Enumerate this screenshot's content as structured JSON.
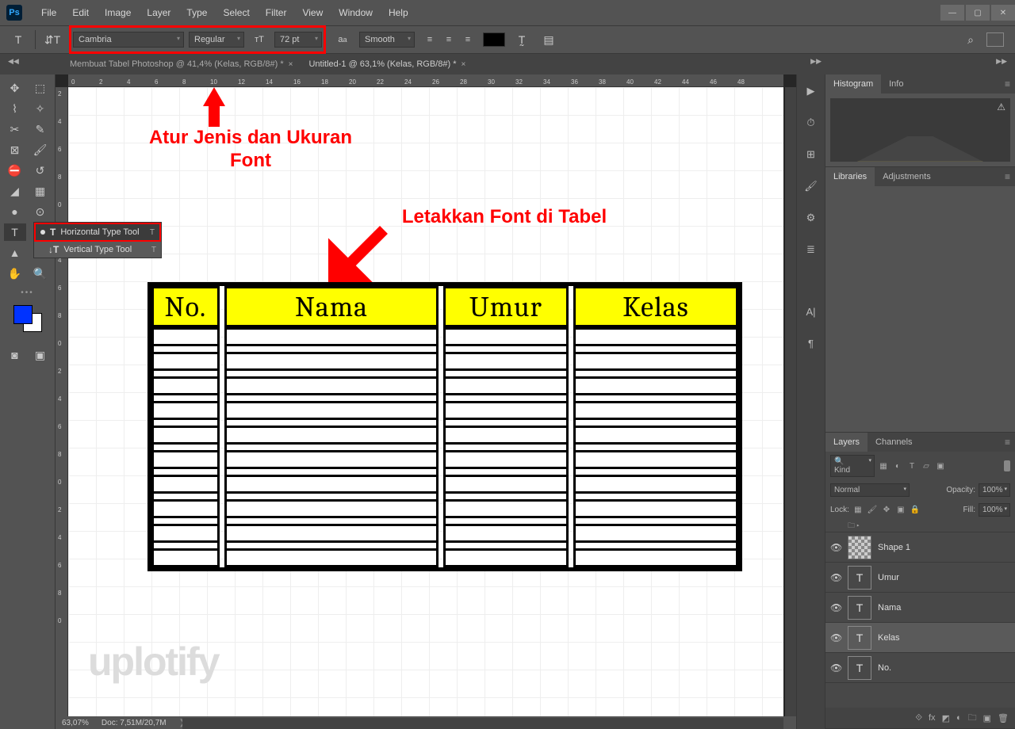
{
  "app": {
    "logo": "Ps"
  },
  "menu": [
    "File",
    "Edit",
    "Image",
    "Layer",
    "Type",
    "Select",
    "Filter",
    "View",
    "Window",
    "Help"
  ],
  "options": {
    "font": "Cambria",
    "style": "Regular",
    "size": "72 pt",
    "aa": "Smooth"
  },
  "tabs": [
    {
      "label": "Membuat Tabel Photoshop @ 41,4% (Kelas, RGB/8#) *",
      "active": false
    },
    {
      "label": "Untitled-1 @ 63,1% (Kelas, RGB/8#) *",
      "active": true
    }
  ],
  "flyout": {
    "items": [
      {
        "label": "Horizontal Type Tool",
        "shortcut": "T",
        "selected": true
      },
      {
        "label": "Vertical Type Tool",
        "shortcut": "T",
        "selected": false
      }
    ]
  },
  "ruler_h": [
    "0",
    "2",
    "4",
    "6",
    "8",
    "10",
    "12",
    "14",
    "16",
    "18",
    "20",
    "22",
    "24",
    "26",
    "28",
    "30",
    "32",
    "34",
    "36",
    "38",
    "40",
    "42",
    "44",
    "46",
    "48"
  ],
  "ruler_v": [
    "2",
    "4",
    "6",
    "8",
    "0",
    "2",
    "4",
    "6",
    "8",
    "0",
    "2",
    "4",
    "6",
    "8",
    "0",
    "2",
    "4",
    "6",
    "8",
    "0"
  ],
  "annotations": {
    "anno1": "Atur Jenis dan Ukuran Font",
    "anno2": "Letakkan Font di Tabel"
  },
  "table": {
    "headers": [
      "No.",
      "Nama",
      "Umur",
      "Kelas"
    ],
    "body_rows": 10
  },
  "panels": {
    "histogram_tabs": [
      "Histogram",
      "Info"
    ],
    "lib_tabs": [
      "Libraries",
      "Adjustments"
    ],
    "layers_tabs": [
      "Layers",
      "Channels"
    ],
    "kind": "Kind",
    "blend": "Normal",
    "opacity_label": "Opacity:",
    "opacity": "100%",
    "lock_label": "Lock:",
    "fill_label": "Fill:",
    "fill": "100%",
    "layers": [
      {
        "name": "Shape 1",
        "type": "shape"
      },
      {
        "name": "Umur",
        "type": "text"
      },
      {
        "name": "Nama",
        "type": "text"
      },
      {
        "name": "Kelas",
        "type": "text",
        "selected": true
      },
      {
        "name": "No.",
        "type": "text"
      }
    ]
  },
  "status": {
    "zoom": "63,07%",
    "doc": "Doc: 7,51M/20,7M"
  },
  "watermark": "uplotify"
}
